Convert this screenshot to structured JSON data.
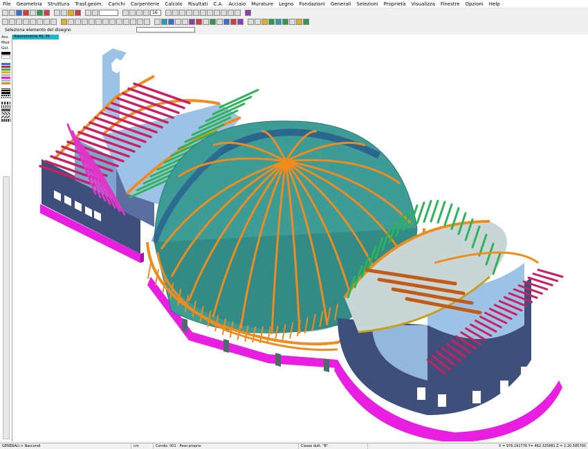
{
  "menu": [
    "File",
    "Geometria",
    "Struttura",
    "Trasf.geom.",
    "Carichi",
    "Carpenterie",
    "Calcolo",
    "Risultati",
    "C.A.",
    "Acciaio",
    "Murature",
    "Legno",
    "Fondazioni",
    "Generali",
    "Selezioni",
    "Proprietà",
    "Visualizza",
    "Finestre",
    "Opzioni",
    "Help"
  ],
  "toolbar": {
    "zoom_value": "16"
  },
  "selection": {
    "label": "Seleziona  elemento del disegno"
  },
  "left_panel": {
    "labels": [
      "Ass.",
      "Mod",
      "Gol."
    ]
  },
  "viewport": {
    "tag": "Assonometria    40, 35"
  },
  "status": {
    "mode": "GENERALI-> Nascondi",
    "unit": "cm",
    "condition": "Condiz. 001 : Peso proprio",
    "class": "Classe dutt. \"B\"",
    "coords": "X = 976.191776 Y= 482.325881 Z = 1:20.585700"
  },
  "colors": {
    "dome": "#3e9c96",
    "rib": "#f08c1e",
    "beam_green": "#2fb35a",
    "beam_red": "#c82060",
    "base_magenta": "#e81ee0",
    "wall_blue": "#9cc2e6",
    "wall_dark": "#3d4f7a",
    "tag": "#20b5c8"
  }
}
